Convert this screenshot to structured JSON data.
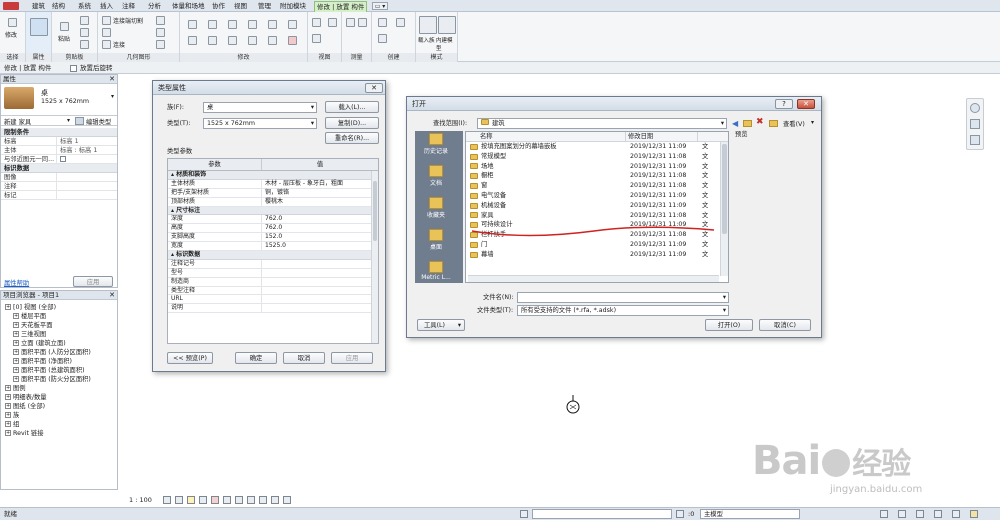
{
  "ribbon": {
    "tabs": [
      "建筑",
      "结构",
      "系统",
      "插入",
      "注释",
      "分析",
      "体量和场地",
      "协作",
      "视图",
      "管理",
      "附加模块",
      "修改 | 放置 构件"
    ],
    "panels": {
      "select": "选择",
      "properties": "属性",
      "clipboard": "剪贴板",
      "geometry": "几何图形",
      "modify": "修改",
      "view": "视图",
      "measure": "测量",
      "create": "创建",
      "mode": "模式"
    },
    "small_labels": {
      "modify": "修改",
      "paste": "粘贴",
      "cut": "连接端切割",
      "join": "连接",
      "load_family": "载入族",
      "inplace_model": "内建模型"
    }
  },
  "context_bar": {
    "label": "修改 | 放置 构件",
    "checkbox": "放置后旋转"
  },
  "properties_panel": {
    "title": "属性",
    "family_name": "桌",
    "family_type": "1525 x 762mm",
    "new_label": "新建 家具",
    "edit_type": "编辑类型",
    "section_constraints": "限制条件",
    "rows": [
      {
        "k": "标高",
        "v": "标高 1"
      },
      {
        "k": "主体",
        "v": "标高 : 标高 1"
      },
      {
        "k": "与邻近图元一同...",
        "v": ""
      }
    ],
    "section_identity": "标识数据",
    "rows2": [
      {
        "k": "图像",
        "v": ""
      },
      {
        "k": "注释",
        "v": ""
      },
      {
        "k": "标记",
        "v": ""
      }
    ],
    "help": "属性帮助",
    "apply": "应用"
  },
  "project_browser": {
    "title": "项目浏览器 - 项目1",
    "items": [
      "[0] 视图 (全部)",
      "楼层平面",
      "天花板平面",
      "三维视图",
      "立面 (建筑立面)",
      "面积平面 (人防分区面积)",
      "面积平面 (净面积)",
      "面积平面 (总建筑面积)",
      "面积平面 (防火分区面积)",
      "图例",
      "明细表/数量",
      "图纸 (全部)",
      "族",
      "组",
      "Revit 链接"
    ]
  },
  "type_dialog": {
    "title": "类型属性",
    "family_label": "族(F):",
    "family_value": "桌",
    "type_label": "类型(T):",
    "type_value": "1525 x 762mm",
    "load_btn": "载入(L)...",
    "duplicate_btn": "复制(D)...",
    "rename_btn": "重命名(R)...",
    "params_label": "类型参数",
    "col_param": "参数",
    "col_value": "值",
    "sections": [
      {
        "name": "材质和装饰",
        "rows": [
          {
            "k": "主体材质",
            "v": "木材 - 层压板 - 象牙白，粗面"
          },
          {
            "k": "把手/支架材质",
            "v": "铜，镀铬"
          },
          {
            "k": "顶部材质",
            "v": "樱桃木"
          }
        ]
      },
      {
        "name": "尺寸标注",
        "rows": [
          {
            "k": "深度",
            "v": "762.0"
          },
          {
            "k": "高度",
            "v": "762.0"
          },
          {
            "k": "支脚高度",
            "v": "152.0"
          },
          {
            "k": "宽度",
            "v": "1525.0"
          }
        ]
      },
      {
        "name": "标识数据",
        "rows": [
          {
            "k": "注释记号",
            "v": ""
          },
          {
            "k": "型号",
            "v": ""
          },
          {
            "k": "制造商",
            "v": ""
          },
          {
            "k": "类型注释",
            "v": ""
          },
          {
            "k": "URL",
            "v": ""
          },
          {
            "k": "说明",
            "v": ""
          }
        ]
      }
    ],
    "preview_btn": "<< 预览(P)",
    "ok_btn": "确定",
    "cancel_btn": "取消",
    "apply_btn": "应用"
  },
  "open_dialog": {
    "title": "打开",
    "lookin_label": "查找范围(I):",
    "lookin_value": "建筑",
    "view_btn": "查看(V)",
    "preview_label": "预览",
    "col_name": "名称",
    "col_date": "修改日期",
    "places": [
      "历史记录",
      "文档",
      "收藏夹",
      "桌面",
      "Metric L..."
    ],
    "files": [
      {
        "n": "按填充图案划分的幕墙嵌板",
        "d": "2019/12/31 11:09",
        "t": "文"
      },
      {
        "n": "常规模型",
        "d": "2019/12/31 11:08",
        "t": "文"
      },
      {
        "n": "场地",
        "d": "2019/12/31 11:09",
        "t": "文"
      },
      {
        "n": "橱柜",
        "d": "2019/12/31 11:08",
        "t": "文"
      },
      {
        "n": "窗",
        "d": "2019/12/31 11:08",
        "t": "文"
      },
      {
        "n": "电气设备",
        "d": "2019/12/31 11:09",
        "t": "文"
      },
      {
        "n": "机械设备",
        "d": "2019/12/31 11:09",
        "t": "文"
      },
      {
        "n": "家具",
        "d": "2019/12/31 11:08",
        "t": "文"
      },
      {
        "n": "可持续设计",
        "d": "2019/12/31 11:09",
        "t": "文"
      },
      {
        "n": "栏杆扶手",
        "d": "2019/12/31 11:08",
        "t": "文"
      },
      {
        "n": "门",
        "d": "2019/12/31 11:09",
        "t": "文"
      },
      {
        "n": "幕墙",
        "d": "2019/12/31 11:09",
        "t": "文"
      }
    ],
    "filename_label": "文件名(N):",
    "filetype_label": "文件类型(T):",
    "filetype_value": "所有受支持的文件 (*.rfa, *.adsk)",
    "tools_btn": "工具(L)",
    "open_btn": "打开(O)",
    "cancel_btn": "取消(C)"
  },
  "view_bar": {
    "scale": "1 : 100"
  },
  "status_bar": {
    "ready": "就绪",
    "zero": ":0",
    "model": "主模型"
  },
  "watermark": {
    "brand": "Bai",
    "brand2": "经验",
    "url": "jingyan.baidu.com"
  }
}
